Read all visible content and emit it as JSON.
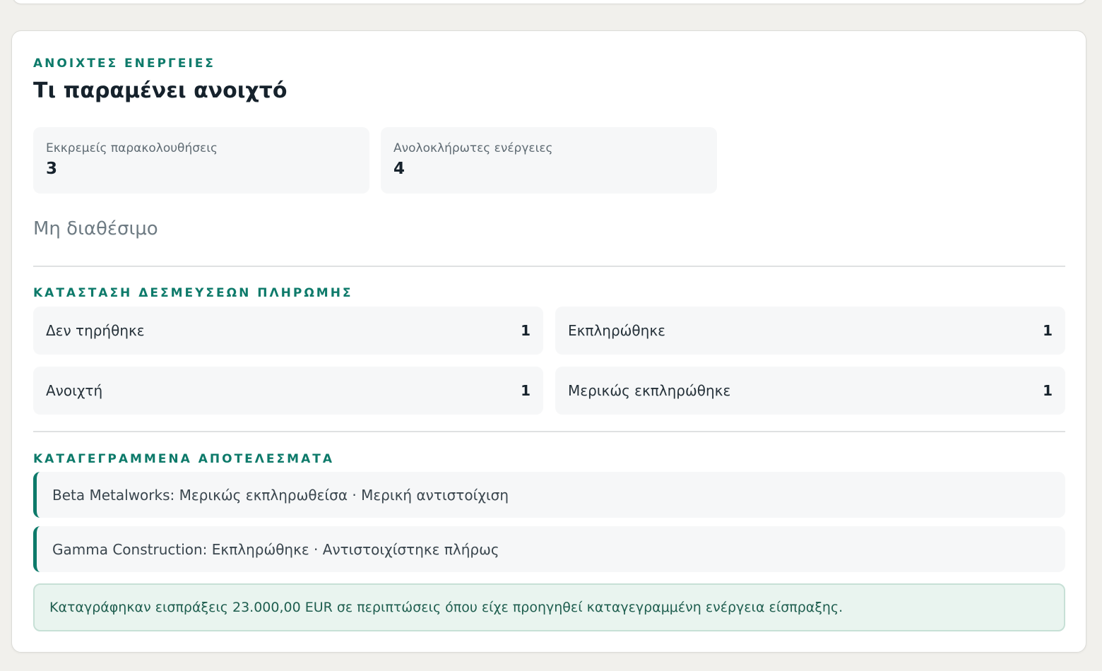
{
  "open_actions": {
    "eyebrow": "ΑΝΟΙΧΤΕΣ ΕΝΕΡΓΕΙΕΣ",
    "title": "Τι παραμένει ανοιχτό",
    "stats": [
      {
        "label": "Εκκρεμείς παρακολουθήσεις",
        "value": "3"
      },
      {
        "label": "Ανολοκλήρωτες ενέργειες",
        "value": "4"
      }
    ],
    "unavailable_text": "Μη διαθέσιμο"
  },
  "payment_commitments": {
    "title": "ΚΑΤΑΣΤΑΣΗ ΔΕΣΜΕΥΣΕΩΝ ΠΛΗΡΩΜΗΣ",
    "items": [
      {
        "label": "Δεν τηρήθηκε",
        "count": "1"
      },
      {
        "label": "Εκπληρώθηκε",
        "count": "1"
      },
      {
        "label": "Ανοιχτή",
        "count": "1"
      },
      {
        "label": "Μερικώς εκπληρώθηκε",
        "count": "1"
      }
    ]
  },
  "recorded_outcomes": {
    "title": "ΚΑΤΑΓΕΓΡΑΜΜΕΝΑ ΑΠΟΤΕΛΕΣΜΑΤΑ",
    "items": [
      "Beta Metalworks: Μερικώς εκπληρωθείσα · Μερική αντιστοίχιση",
      "Gamma Construction: Εκπληρώθηκε · Αντιστοιχίστηκε πλήρως"
    ],
    "note": "Καταγράφηκαν εισπράξεις 23.000,00 EUR σε περιπτώσεις όπου είχε προηγηθεί καταγεγραμμένη ενέργεια είσπραξης."
  },
  "colors": {
    "accent": "#0d7a6a",
    "page_background": "#f1f0ec",
    "card_background": "#ffffff",
    "tile_background": "#f6f7f8",
    "note_background": "#e9f4ef"
  }
}
